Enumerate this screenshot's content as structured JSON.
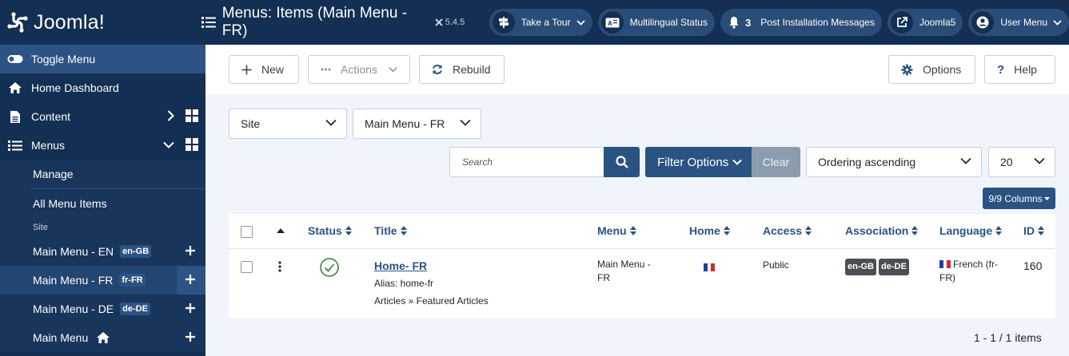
{
  "brand": {
    "name": "Joomla!"
  },
  "header": {
    "title": "Menus: Items (Main Menu - FR)",
    "version": "5.4.5",
    "buttons": [
      {
        "label": "Take a Tour",
        "icon": "signpost-icon"
      },
      {
        "label": "Multilingual Status",
        "icon": "language-icon"
      },
      {
        "label": "Post Installation Messages",
        "icon": "bell-icon",
        "count": "3"
      },
      {
        "label": "Joomla5",
        "icon": "external-link-icon"
      },
      {
        "label": "User Menu",
        "icon": "user-icon"
      }
    ]
  },
  "sidebar": {
    "toggle": "Toggle Menu",
    "home": "Home Dashboard",
    "content": "Content",
    "menus": "Menus",
    "sub": {
      "manage": "Manage",
      "all_items": "All Menu Items",
      "site_heading": "Site",
      "menus": [
        {
          "label": "Main Menu - EN",
          "badge": "en-GB"
        },
        {
          "label": "Main Menu - FR",
          "badge": "fr-FR"
        },
        {
          "label": "Main Menu - DE",
          "badge": "de-DE"
        },
        {
          "label": "Main Menu"
        }
      ]
    }
  },
  "toolbar": {
    "new": "New",
    "actions": "Actions",
    "rebuild": "Rebuild",
    "options": "Options",
    "help": "Help"
  },
  "filters": {
    "client": "Site",
    "menu": "Main Menu - FR",
    "search_placeholder": "Search",
    "filter_options": "Filter Options",
    "clear": "Clear",
    "ordering": "Ordering ascending",
    "limit": "20",
    "columns": "9/9 Columns"
  },
  "table": {
    "headers": {
      "status": "Status",
      "title": "Title",
      "menu": "Menu",
      "home": "Home",
      "access": "Access",
      "association": "Association",
      "language": "Language",
      "id": "ID"
    },
    "rows": [
      {
        "title": "Home- FR",
        "alias": "Alias: home-fr",
        "link": "Articles » Featured Articles",
        "menu": "Main Menu - FR",
        "access": "Public",
        "associations": [
          "en-GB",
          "de-DE"
        ],
        "language": "French (fr-FR)",
        "id": "160"
      }
    ]
  },
  "pagination": {
    "summary": "1 - 1 / 1 items"
  },
  "colors": {
    "dark_blue": "#132f53",
    "primary": "#2a5381",
    "success": "#2f7d32"
  }
}
